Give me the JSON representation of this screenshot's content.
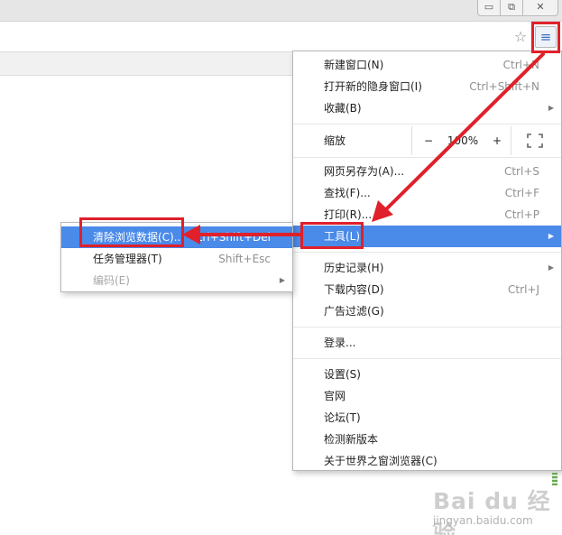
{
  "window": {
    "min_glyph": "▭",
    "max_glyph": "⧉",
    "close_glyph": "✕"
  },
  "toolbar": {
    "star_glyph": "☆",
    "menu_glyph": "≡",
    "highlight_color": "#e0202a"
  },
  "main_menu": {
    "highlight_color": "#4a8ae8",
    "items": [
      {
        "label": "新建窗口(N)",
        "shortcut": "Ctrl+N"
      },
      {
        "label": "打开新的隐身窗口(I)",
        "shortcut": "Ctrl+Shift+N"
      },
      {
        "label": "收藏(B)",
        "arrow": "▶"
      },
      {
        "label": "网页另存为(A)...",
        "shortcut": "Ctrl+S"
      },
      {
        "label": "查找(F)...",
        "shortcut": "Ctrl+F"
      },
      {
        "label": "打印(R)...",
        "shortcut": "Ctrl+P"
      },
      {
        "label": "工具(L)",
        "arrow": "▶"
      },
      {
        "label": "历史记录(H)",
        "arrow": "▶"
      },
      {
        "label": "下载内容(D)",
        "shortcut": "Ctrl+J"
      },
      {
        "label": "广告过滤(G)"
      },
      {
        "label": "登录..."
      },
      {
        "label": "设置(S)"
      },
      {
        "label": "官网"
      },
      {
        "label": "论坛(T)"
      },
      {
        "label": "检测新版本"
      },
      {
        "label": "关于世界之窗浏览器(C)"
      }
    ],
    "zoom": {
      "label": "缩放",
      "minus": "−",
      "level": "100%",
      "plus": "+"
    }
  },
  "tools_submenu": {
    "items": [
      {
        "label": "清除浏览数据(C)...",
        "shortcut": "Ctrl+Shift+Del"
      },
      {
        "label": "任务管理器(T)",
        "shortcut": "Shift+Esc"
      },
      {
        "label": "编码(E)",
        "arrow": "▶"
      }
    ]
  },
  "watermark": {
    "logo_text": "Bai du 经验",
    "url": "jingyan.baidu.com"
  }
}
